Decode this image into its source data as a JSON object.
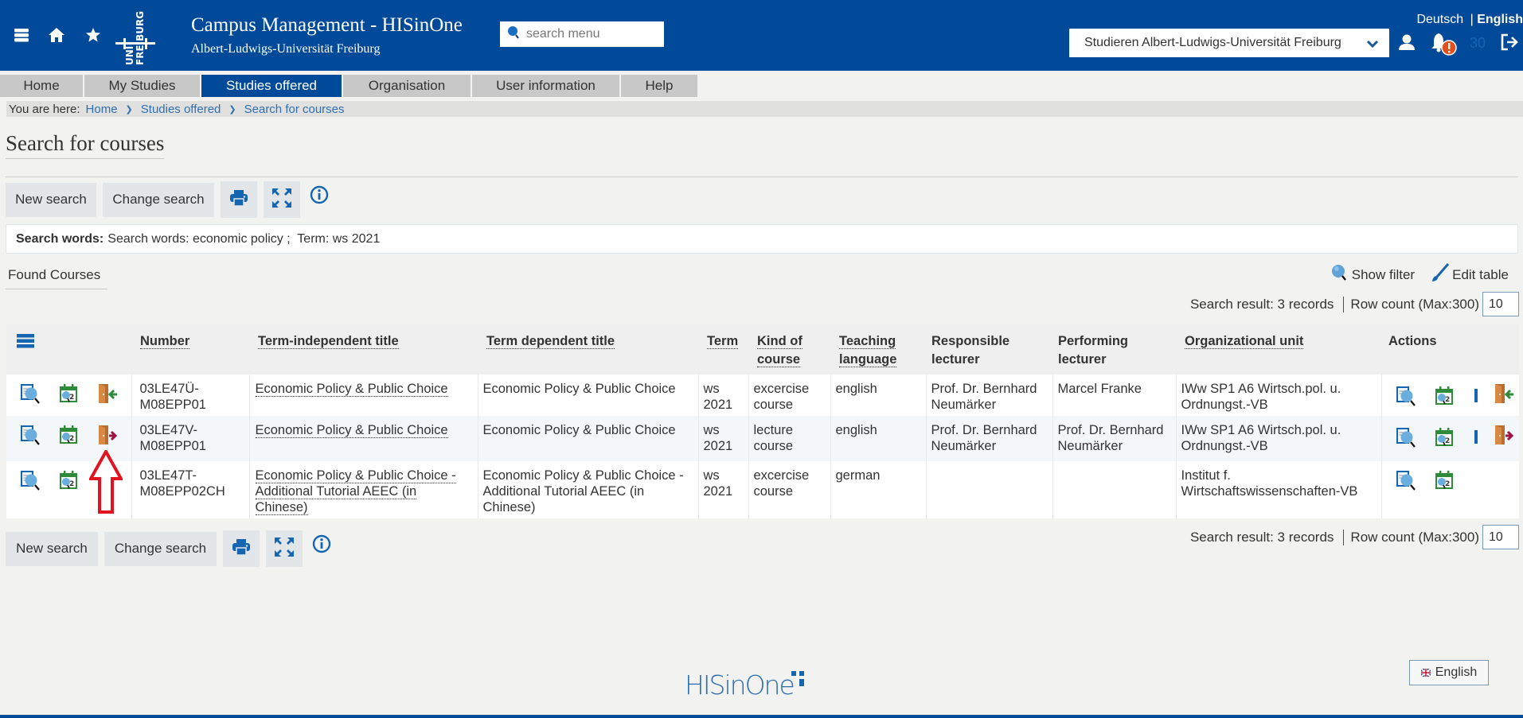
{
  "header": {
    "app_title": "Campus Management - HISinOne",
    "app_subtitle": "Albert-Ludwigs-Universität Freiburg",
    "logo_text_top": "UNI",
    "logo_text_bottom": "FREIBURG",
    "search_placeholder": "search menu",
    "lang_deutsch": "Deutsch",
    "lang_separator": "|",
    "lang_english": "English",
    "role_select_value": "Studieren Albert-Ludwigs-Universität Freiburg",
    "session_counter": "30",
    "icons": [
      "menu-icon",
      "home-icon",
      "star-icon",
      "search-icon",
      "chevron-down-icon",
      "user-icon",
      "bell-icon",
      "alert-badge-icon",
      "logout-icon"
    ]
  },
  "tabs": [
    {
      "label": "Home",
      "active": false
    },
    {
      "label": "My Studies",
      "active": false
    },
    {
      "label": "Studies offered",
      "active": true
    },
    {
      "label": "Organisation",
      "active": false
    },
    {
      "label": "User information",
      "active": false
    },
    {
      "label": "Help",
      "active": false
    }
  ],
  "breadcrumb": {
    "prefix": "You are here:",
    "items": [
      "Home",
      "Studies offered",
      "Search for courses"
    ]
  },
  "page": {
    "title": "Search for courses"
  },
  "toolbar": {
    "new_search": "New search",
    "change_search": "Change search",
    "icons": [
      "print-icon",
      "expand-icon",
      "info-icon"
    ]
  },
  "search_words": {
    "label": "Search words:",
    "value": "Search words: economic policy ;  Term: ws 2021"
  },
  "results": {
    "section_title": "Found Courses",
    "show_filter": "Show filter",
    "edit_table": "Edit table",
    "result_text": "Search result: 3 records",
    "row_count_label": "Row count (Max:300)",
    "row_count_value": "10"
  },
  "table": {
    "columns": [
      "Number",
      "Term-independent title",
      "Term dependent title",
      "Term",
      "Kind of course",
      "Teaching language",
      "Responsible lecturer",
      "Performing lecturer",
      "Organizational unit",
      "Actions"
    ],
    "rows": [
      {
        "number": "03LE47Ü-M08EPP01",
        "title_independent": "Economic Policy & Public Choice",
        "title_dependent": "Economic Policy & Public Choice",
        "term": "ws 2021",
        "kind": "excercise course",
        "language": "english",
        "responsible": "Prof. Dr. Bernhard Neumärker",
        "performing": "Marcel Franke",
        "org_unit": "IWw SP1 A6 Wirtsch.pol. u. Ordnungst.-VB",
        "enrollment_action": "enroll"
      },
      {
        "number": "03LE47V-M08EPP01",
        "title_independent": "Economic Policy & Public Choice",
        "title_dependent": "Economic Policy & Public Choice",
        "term": "ws 2021",
        "kind": "lecture course",
        "language": "english",
        "responsible": "Prof. Dr. Bernhard Neumärker",
        "performing": "Prof. Dr. Bernhard Neumärker",
        "org_unit": "IWw SP1 A6 Wirtsch.pol. u. Ordnungst.-VB",
        "enrollment_action": "deregister"
      },
      {
        "number": "03LE47T-M08EPP02CH",
        "title_independent": "Economic Policy & Public Choice - Additional Tutorial AEEC (in Chinese)",
        "title_dependent": "Economic Policy & Public Choice - Additional Tutorial AEEC (in Chinese)",
        "term": "ws 2021",
        "kind": "excercise course",
        "language": "german",
        "responsible": "",
        "performing": "",
        "org_unit": "Institut f. Wirtschaftswissenschaften-VB",
        "enrollment_action": ""
      }
    ]
  },
  "footer": {
    "brand": "HISinOne",
    "language_button": "English"
  },
  "colors": {
    "brand_blue": "#004a99",
    "link_blue": "#2f6fb3",
    "enroll_green": "#2e8b3a",
    "deregister_red": "#a01040",
    "annotation_arrow": "#e0141e",
    "alert_orange": "#e0501e"
  }
}
